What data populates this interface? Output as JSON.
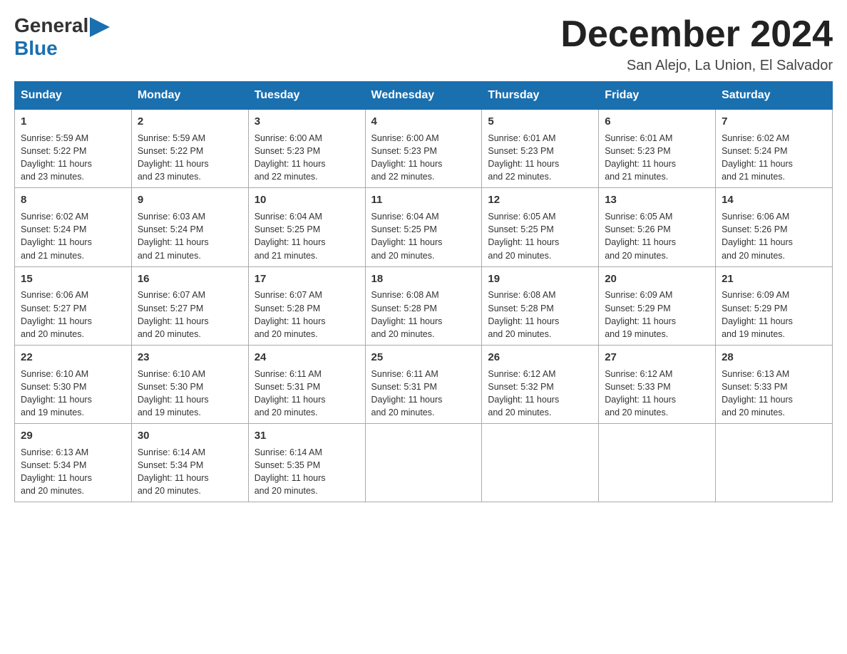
{
  "header": {
    "logo_general": "General",
    "logo_blue": "Blue",
    "month_title": "December 2024",
    "location": "San Alejo, La Union, El Salvador"
  },
  "weekdays": [
    "Sunday",
    "Monday",
    "Tuesday",
    "Wednesday",
    "Thursday",
    "Friday",
    "Saturday"
  ],
  "weeks": [
    [
      {
        "day": "1",
        "sunrise": "5:59 AM",
        "sunset": "5:22 PM",
        "daylight": "11 hours and 23 minutes."
      },
      {
        "day": "2",
        "sunrise": "5:59 AM",
        "sunset": "5:22 PM",
        "daylight": "11 hours and 23 minutes."
      },
      {
        "day": "3",
        "sunrise": "6:00 AM",
        "sunset": "5:23 PM",
        "daylight": "11 hours and 22 minutes."
      },
      {
        "day": "4",
        "sunrise": "6:00 AM",
        "sunset": "5:23 PM",
        "daylight": "11 hours and 22 minutes."
      },
      {
        "day": "5",
        "sunrise": "6:01 AM",
        "sunset": "5:23 PM",
        "daylight": "11 hours and 22 minutes."
      },
      {
        "day": "6",
        "sunrise": "6:01 AM",
        "sunset": "5:23 PM",
        "daylight": "11 hours and 21 minutes."
      },
      {
        "day": "7",
        "sunrise": "6:02 AM",
        "sunset": "5:24 PM",
        "daylight": "11 hours and 21 minutes."
      }
    ],
    [
      {
        "day": "8",
        "sunrise": "6:02 AM",
        "sunset": "5:24 PM",
        "daylight": "11 hours and 21 minutes."
      },
      {
        "day": "9",
        "sunrise": "6:03 AM",
        "sunset": "5:24 PM",
        "daylight": "11 hours and 21 minutes."
      },
      {
        "day": "10",
        "sunrise": "6:04 AM",
        "sunset": "5:25 PM",
        "daylight": "11 hours and 21 minutes."
      },
      {
        "day": "11",
        "sunrise": "6:04 AM",
        "sunset": "5:25 PM",
        "daylight": "11 hours and 20 minutes."
      },
      {
        "day": "12",
        "sunrise": "6:05 AM",
        "sunset": "5:25 PM",
        "daylight": "11 hours and 20 minutes."
      },
      {
        "day": "13",
        "sunrise": "6:05 AM",
        "sunset": "5:26 PM",
        "daylight": "11 hours and 20 minutes."
      },
      {
        "day": "14",
        "sunrise": "6:06 AM",
        "sunset": "5:26 PM",
        "daylight": "11 hours and 20 minutes."
      }
    ],
    [
      {
        "day": "15",
        "sunrise": "6:06 AM",
        "sunset": "5:27 PM",
        "daylight": "11 hours and 20 minutes."
      },
      {
        "day": "16",
        "sunrise": "6:07 AM",
        "sunset": "5:27 PM",
        "daylight": "11 hours and 20 minutes."
      },
      {
        "day": "17",
        "sunrise": "6:07 AM",
        "sunset": "5:28 PM",
        "daylight": "11 hours and 20 minutes."
      },
      {
        "day": "18",
        "sunrise": "6:08 AM",
        "sunset": "5:28 PM",
        "daylight": "11 hours and 20 minutes."
      },
      {
        "day": "19",
        "sunrise": "6:08 AM",
        "sunset": "5:28 PM",
        "daylight": "11 hours and 20 minutes."
      },
      {
        "day": "20",
        "sunrise": "6:09 AM",
        "sunset": "5:29 PM",
        "daylight": "11 hours and 19 minutes."
      },
      {
        "day": "21",
        "sunrise": "6:09 AM",
        "sunset": "5:29 PM",
        "daylight": "11 hours and 19 minutes."
      }
    ],
    [
      {
        "day": "22",
        "sunrise": "6:10 AM",
        "sunset": "5:30 PM",
        "daylight": "11 hours and 19 minutes."
      },
      {
        "day": "23",
        "sunrise": "6:10 AM",
        "sunset": "5:30 PM",
        "daylight": "11 hours and 19 minutes."
      },
      {
        "day": "24",
        "sunrise": "6:11 AM",
        "sunset": "5:31 PM",
        "daylight": "11 hours and 20 minutes."
      },
      {
        "day": "25",
        "sunrise": "6:11 AM",
        "sunset": "5:31 PM",
        "daylight": "11 hours and 20 minutes."
      },
      {
        "day": "26",
        "sunrise": "6:12 AM",
        "sunset": "5:32 PM",
        "daylight": "11 hours and 20 minutes."
      },
      {
        "day": "27",
        "sunrise": "6:12 AM",
        "sunset": "5:33 PM",
        "daylight": "11 hours and 20 minutes."
      },
      {
        "day": "28",
        "sunrise": "6:13 AM",
        "sunset": "5:33 PM",
        "daylight": "11 hours and 20 minutes."
      }
    ],
    [
      {
        "day": "29",
        "sunrise": "6:13 AM",
        "sunset": "5:34 PM",
        "daylight": "11 hours and 20 minutes."
      },
      {
        "day": "30",
        "sunrise": "6:14 AM",
        "sunset": "5:34 PM",
        "daylight": "11 hours and 20 minutes."
      },
      {
        "day": "31",
        "sunrise": "6:14 AM",
        "sunset": "5:35 PM",
        "daylight": "11 hours and 20 minutes."
      },
      null,
      null,
      null,
      null
    ]
  ],
  "labels": {
    "sunrise": "Sunrise:",
    "sunset": "Sunset:",
    "daylight": "Daylight:"
  }
}
